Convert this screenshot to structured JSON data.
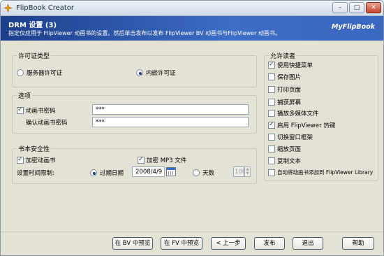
{
  "window": {
    "title": "FlipBook Creator",
    "minimize_label": "–",
    "maximize_label": "□",
    "close_label": "✕"
  },
  "banner": {
    "heading": "DRM 设置 (3)",
    "subtitle": "指定仅应用于 FlipViewer 动画书的设置。然后单击发布以发布 FlipViewer BV 动画书与FlipViewer 动画书。",
    "brand": "MyFlipBook"
  },
  "license": {
    "legend": "许可证类型",
    "options": [
      {
        "label": "服务器许可证",
        "selected": false
      },
      {
        "label": "内嵌许可证",
        "selected": true
      }
    ]
  },
  "options": {
    "legend": "选项",
    "password_label": "动画书密码",
    "password_checked": true,
    "password_value": "***",
    "confirm_label": "确认动画书密码",
    "confirm_value": "***"
  },
  "security": {
    "legend": "书本安全性",
    "encrypt_book_label": "加密动画书",
    "encrypt_book_checked": true,
    "encrypt_mp3_label": "加密 MP3 文件",
    "encrypt_mp3_checked": true,
    "time_limit_label": "设置时间限制:",
    "expiry_label": "过期日期",
    "expiry_selected": true,
    "expiry_value": "2008/4/9",
    "days_label": "天数",
    "days_selected": false,
    "days_value": "100"
  },
  "readers": {
    "legend": "允许读者",
    "items": [
      {
        "label": "使用快捷菜单",
        "checked": true
      },
      {
        "label": "保存图片",
        "checked": false
      },
      {
        "label": "打印页面",
        "checked": false
      },
      {
        "label": "捕获屏幕",
        "checked": false
      },
      {
        "label": "播放多媒体文件",
        "checked": false
      },
      {
        "label": "启用 FlipViewer 热键",
        "checked": true
      },
      {
        "label": "切换窗口框架",
        "checked": false
      },
      {
        "label": "缩放页面",
        "checked": false
      },
      {
        "label": "复制文本",
        "checked": false
      },
      {
        "label": "自动将动画书添加到 FlipViewer Library",
        "checked": false
      }
    ]
  },
  "footer": {
    "preview_bv": "在 BV 中预览",
    "preview_fv": "在 FV 中预览",
    "back": "< 上一步",
    "publish": "发布",
    "exit": "退出",
    "help": "帮助"
  }
}
